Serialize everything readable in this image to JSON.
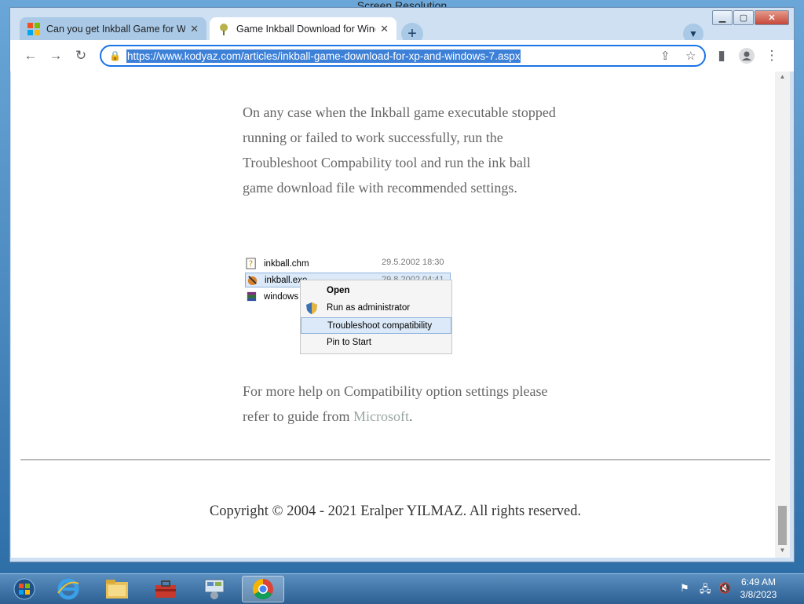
{
  "desktop": {
    "bg_title": "Screen Resolution"
  },
  "browser": {
    "tabs": [
      {
        "title": "Can you get Inkball Game for Windows",
        "active": false
      },
      {
        "title": "Game Inkball Download for Windows",
        "active": true
      }
    ],
    "new_tab_label": "+",
    "url": "https://www.kodyaz.com/articles/inkball-game-download-for-xp-and-windows-7.aspx"
  },
  "article": {
    "paragraph1": "On any case when the Inkball game executable stopped running or failed to work successfully, run the Troubleshoot Compability tool and run the ink ball game download file with recommended settings.",
    "screenshot": {
      "files": [
        {
          "name": "inkball.chm",
          "date": "29.5.2002 18:30"
        },
        {
          "name": "inkball.exe",
          "date": "29.8.2002 04:41"
        },
        {
          "name": "windows"
        }
      ],
      "context_menu": [
        "Open",
        "Run as administrator",
        "Troubleshoot compatibility",
        "Pin to Start"
      ],
      "selected_item": "Troubleshoot compatibility"
    },
    "paragraph2_before": "For more help on Compatibility option settings please refer to guide from ",
    "paragraph2_link": "Microsoft",
    "paragraph2_after": "."
  },
  "footer": {
    "copyright": "Copyright © 2004 - 2021 Eralper YILMAZ. All rights reserved."
  },
  "taskbar": {
    "time": "6:49 AM",
    "date": "3/8/2023"
  },
  "colors": {
    "accent": "#1a73e8",
    "selection": "#3c80d8",
    "taskbar": "#2d5f92"
  }
}
